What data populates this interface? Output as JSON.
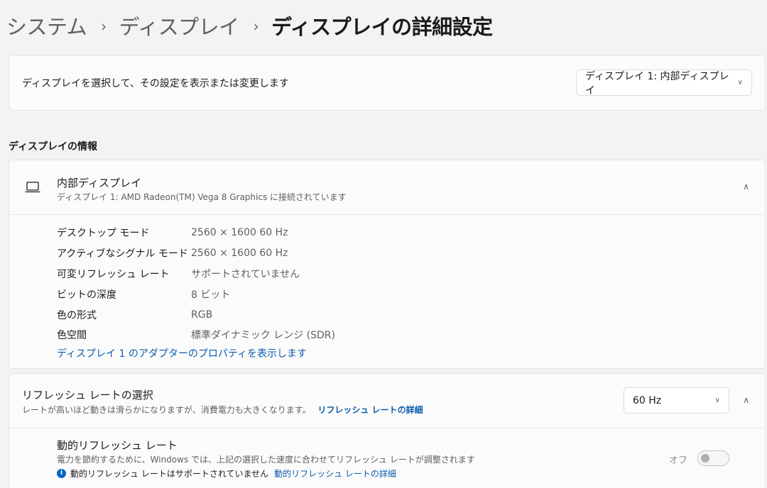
{
  "breadcrumb": {
    "items": [
      "システム",
      "ディスプレイ"
    ],
    "current": "ディスプレイの詳細設定",
    "separator": "›"
  },
  "display_select": {
    "label": "ディスプレイを選択して、その設定を表示または変更します",
    "selected": "ディスプレイ 1: 内部ディスプレイ"
  },
  "display_info": {
    "section_title": "ディスプレイの情報",
    "title": "内部ディスプレイ",
    "subtitle": "ディスプレイ 1: AMD Radeon(TM) Vega 8 Graphics に接続されています",
    "rows": [
      {
        "key": "デスクトップ モード",
        "value": "2560 × 1600 60 Hz"
      },
      {
        "key": "アクティブなシグナル モード",
        "value": "2560 × 1600 60 Hz"
      },
      {
        "key": "可変リフレッシュ レート",
        "value": "サポートされていません"
      },
      {
        "key": "ビットの深度",
        "value": "8 ビット"
      },
      {
        "key": "色の形式",
        "value": "RGB"
      },
      {
        "key": "色空間",
        "value": "標準ダイナミック レンジ (SDR)"
      }
    ],
    "adapter_link": "ディスプレイ 1 のアダプターのプロパティを表示します"
  },
  "refresh": {
    "title": "リフレッシュ レートの選択",
    "subtitle": "レートが高いほど動きは滑らかになりますが、消費電力も大きくなります。",
    "details_link": "リフレッシュ レートの詳細",
    "selected": "60 Hz"
  },
  "dynamic_refresh": {
    "title": "動的リフレッシュ レート",
    "subtitle": "電力を節約するために、Windows では、上記の選択した速度に合わせてリフレッシュ レートが調整されます",
    "note": "動的リフレッシュ レートはサポートされていません",
    "details_link": "動的リフレッシュ レートの詳細",
    "toggle_label": "オフ"
  },
  "icons": {
    "chevron_down": "chevron-down-icon",
    "chevron_up": "chevron-up-icon",
    "laptop": "laptop-icon",
    "info": "info-icon"
  },
  "colors": {
    "accent": "#0067c0",
    "link": "#0b5cad",
    "background": "#f3f3f3",
    "card": "#fbfbfb"
  }
}
